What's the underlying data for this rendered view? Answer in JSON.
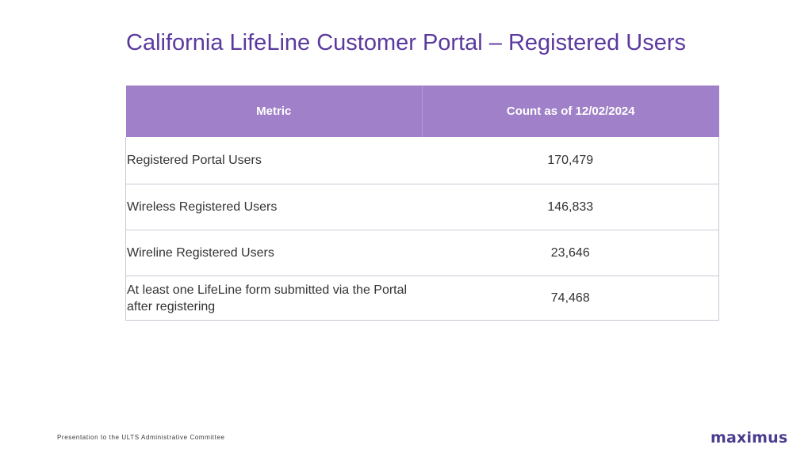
{
  "title": "California LifeLine Customer Portal – Registered Users",
  "table": {
    "headers": {
      "metric": "Metric",
      "count": "Count as of 12/02/2024"
    },
    "rows": [
      {
        "metric": "Registered Portal Users",
        "count": "170,479"
      },
      {
        "metric": "Wireless Registered Users",
        "count": "146,833"
      },
      {
        "metric": "Wireline Registered Users",
        "count": "23,646"
      },
      {
        "metric": "At least one LifeLine form submitted via the Portal after registering",
        "count": "74,468"
      }
    ]
  },
  "footer": {
    "text": "Presentation to the ULTS Administrative Committee"
  },
  "brand": {
    "logo_text": "maximus"
  },
  "colors": {
    "title": "#5b3a9e",
    "header_bg": "#a080c8",
    "brand": "#4a3d8f"
  }
}
